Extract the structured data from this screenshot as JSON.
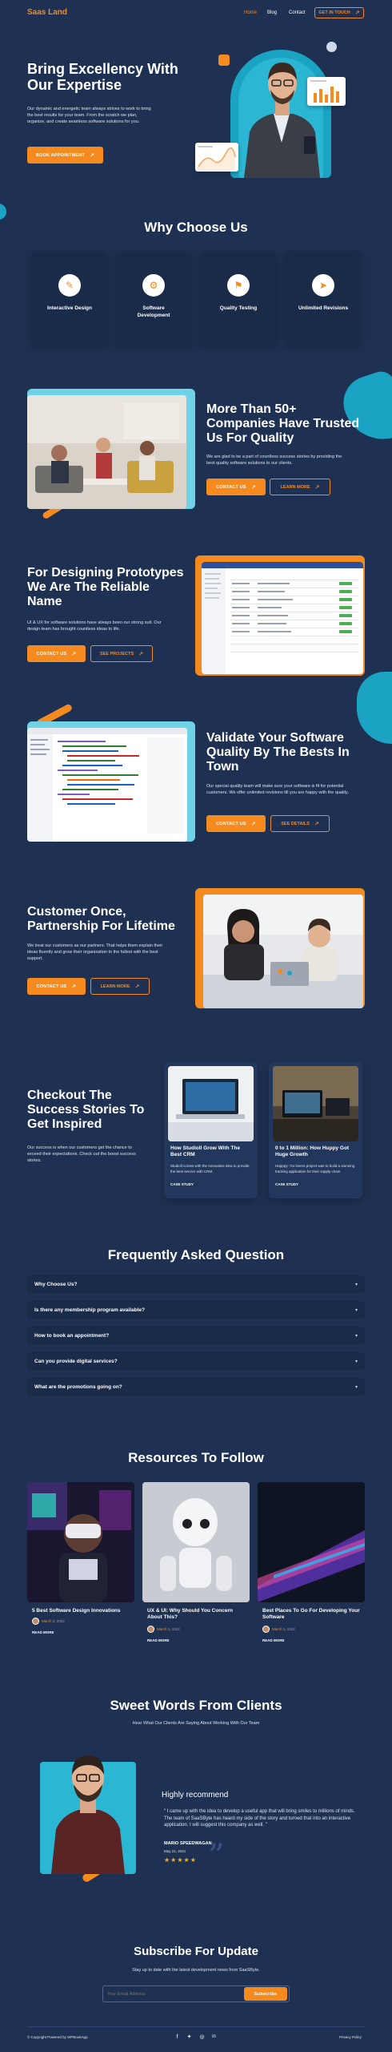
{
  "header": {
    "logo": "Saas Land",
    "nav": [
      "Home",
      "Blog",
      "Contact"
    ],
    "cta": "GET IN TOUCH"
  },
  "hero": {
    "title": "Bring Excellency With Our Expertise",
    "text": "Our dynamic and energetic team always strives to work to bring the best results for your team. From the scratch we plan, organize, and create seamless software solutions for you.",
    "button": "BOOK APPOINTMENT"
  },
  "why": {
    "title": "Why Choose Us",
    "items": [
      {
        "label": "Interactive Design",
        "icon": "design-icon"
      },
      {
        "label": "Software Development",
        "icon": "development-icon"
      },
      {
        "label": "Quality Testing",
        "icon": "testing-icon"
      },
      {
        "label": "Unlimited Revisions",
        "icon": "revision-icon"
      }
    ]
  },
  "trusted": {
    "title": "More Than 50+ Companies Have Trusted Us For Quality",
    "text": "We are glad to be a part of countless success stories by providing the best quality software solutions to our clients.",
    "primary": "CONTACT US",
    "secondary": "LEARN MORE"
  },
  "prototypes": {
    "title": "For Designing Prototypes We Are The Reliable Name",
    "text": "UI & UX for software solutions have always been our strong suit. Our design team has brought countless ideas to life.",
    "primary": "CONTACT US",
    "secondary": "SEE PROJECTS"
  },
  "validate": {
    "title": "Validate Your Software Quality By The Bests In Town",
    "text": "Our special quality team will make sure your software is fit for potential customers. We offer unlimited revisions till you are happy with the quality.",
    "primary": "CONTACT US",
    "secondary": "SEE DETAILS"
  },
  "partnership": {
    "title": "Customer Once, Partnership For Lifetime",
    "text": "We treat our customers as our partners. That helps them explain their ideas fluently and grow their organization to the fullest with the best support.",
    "primary": "CONTACT US",
    "secondary": "LEARN MORE"
  },
  "stories": {
    "title": "Checkout The Success Stories To Get Inspired",
    "text": "Our success is when our customers get the chance to exceed their expectations. Check out the boost success stories.",
    "cards": [
      {
        "title": "How Studioll Grow With The Best CRM",
        "text": "Studioll comes with the Innovative idea to provide the best service with CRM.",
        "link": "CASE STUDY"
      },
      {
        "title": "0 to 1 Million: How Huppy Got Huge Growth",
        "text": "Happpy- Go lovers project was to build a stunning tracking application for their supply chain.",
        "link": "CASE STUDY"
      }
    ]
  },
  "faq": {
    "title": "Frequently Asked Question",
    "items": [
      "Why Choose Us?",
      "Is there any membership program available?",
      "How to book an appointment?",
      "Can you provide digital services?",
      "What are the promotions going on?"
    ]
  },
  "resources": {
    "title": "Resources To Follow",
    "items": [
      {
        "title": "5 Best Software Design Innovations",
        "date": "March 3, 2022",
        "read": "READ MORE"
      },
      {
        "title": "UX & UI: Why Should You Concern About This?",
        "date": "March 3, 2022",
        "read": "READ MORE"
      },
      {
        "title": "Best Places To Go For Developing Your Software",
        "date": "March 3, 2022",
        "read": "READ MORE"
      }
    ]
  },
  "testimonial": {
    "title": "Sweet Words From Clients",
    "subtitle": "Hear What Our Clients Are Saying About Working With Our Team",
    "heading": "Highly recommend",
    "quote": "“ I came up with the idea to develop a useful app that will bring smiles to millions of minds. The team of SaaSByte has heard my side of the story and turned that into an interactive application. I will suggest this company as well. ”",
    "name": "MARIO SPEEDWAGAN",
    "date": "May 21, 2021",
    "stars": "★★★★★",
    "rating": 5
  },
  "subscribe": {
    "title": "Subscribe For Update",
    "text": "Stay up to date with the latest development news from SaaSByte.",
    "placeholder": "Your Email Address",
    "button": "Subscribe"
  },
  "footer": {
    "copyright": "© Copyright Powered by WPBookApp",
    "policy": "Privacy Policy",
    "social": [
      "facebook-icon",
      "twitter-icon",
      "instagram-icon",
      "linkedin-icon"
    ]
  },
  "colors": {
    "bg": "#1f3152",
    "card": "#1a2b4a",
    "accent": "#f58a1f",
    "teal": "#1aa3c2"
  }
}
